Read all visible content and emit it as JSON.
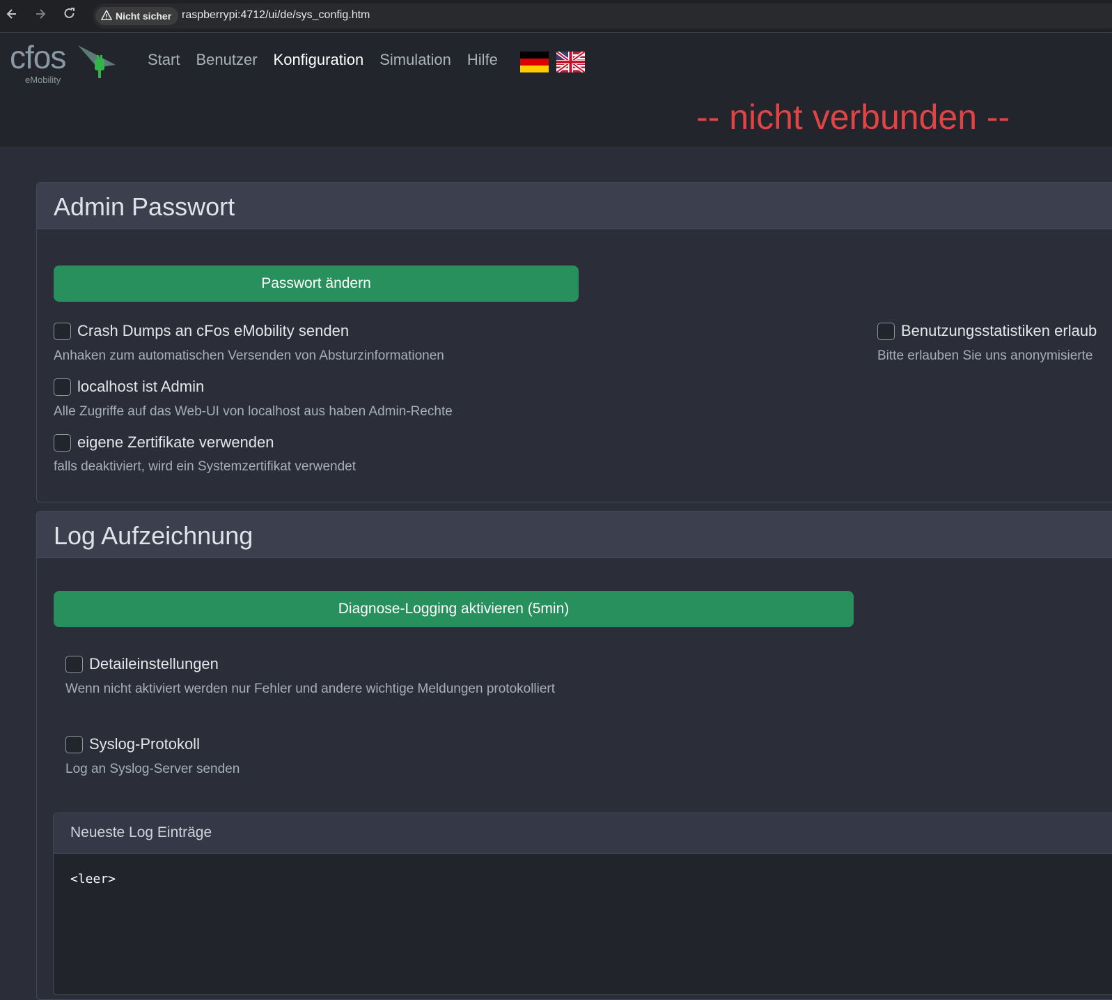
{
  "browser": {
    "back_icon": "arrow-left-icon",
    "forward_icon": "arrow-right-icon",
    "reload_icon": "reload-icon",
    "security_label": "Nicht sicher",
    "url": "raspberrypi:4712/ui/de/sys_config.htm"
  },
  "header": {
    "logo_text": "cfos",
    "logo_sub": "eMobility",
    "nav": [
      {
        "label": "Start"
      },
      {
        "label": "Benutzer"
      },
      {
        "label": "Konfiguration"
      },
      {
        "label": "Simulation"
      },
      {
        "label": "Hilfe"
      }
    ],
    "status": "-- nicht verbunden --",
    "status_color": "#e04444",
    "flags": [
      "german-flag-icon",
      "uk-us-flag-icon"
    ]
  },
  "admin": {
    "title": "Admin Passwort",
    "change_password_label": "Passwort ändern",
    "options": [
      {
        "label": "Crash Dumps an cFos eMobility senden",
        "help": "Anhaken zum automatischen Versenden von Absturzinformationen",
        "checked": false
      },
      {
        "label": "localhost ist Admin",
        "help": "Alle Zugriffe auf das Web-UI von localhost aus haben Admin-Rechte",
        "checked": false
      },
      {
        "label": "eigene Zertifikate verwenden",
        "help": "falls deaktiviert, wird ein Systemzertifikat verwendet",
        "checked": false
      }
    ],
    "stats_option": {
      "label": "Benutzungsstatistiken erlaub",
      "help": "Bitte erlauben Sie uns anonymisierte",
      "checked": false
    }
  },
  "log": {
    "title": "Log Aufzeichnung",
    "diag_button_label": "Diagnose-Logging aktivieren (5min)",
    "options": [
      {
        "label": "Detaileinstellungen",
        "help": "Wenn nicht aktiviert werden nur Fehler und andere wichtige Meldungen protokolliert",
        "checked": false
      },
      {
        "label": "Syslog-Protokoll",
        "help": "Log an Syslog-Server senden",
        "checked": false
      }
    ],
    "entries_title": "Neueste Log Einträge",
    "entries_content": "<leer>"
  },
  "colors": {
    "accent_green": "#28905c",
    "background": "#2b2d38",
    "card_header": "#3b3f4e"
  }
}
